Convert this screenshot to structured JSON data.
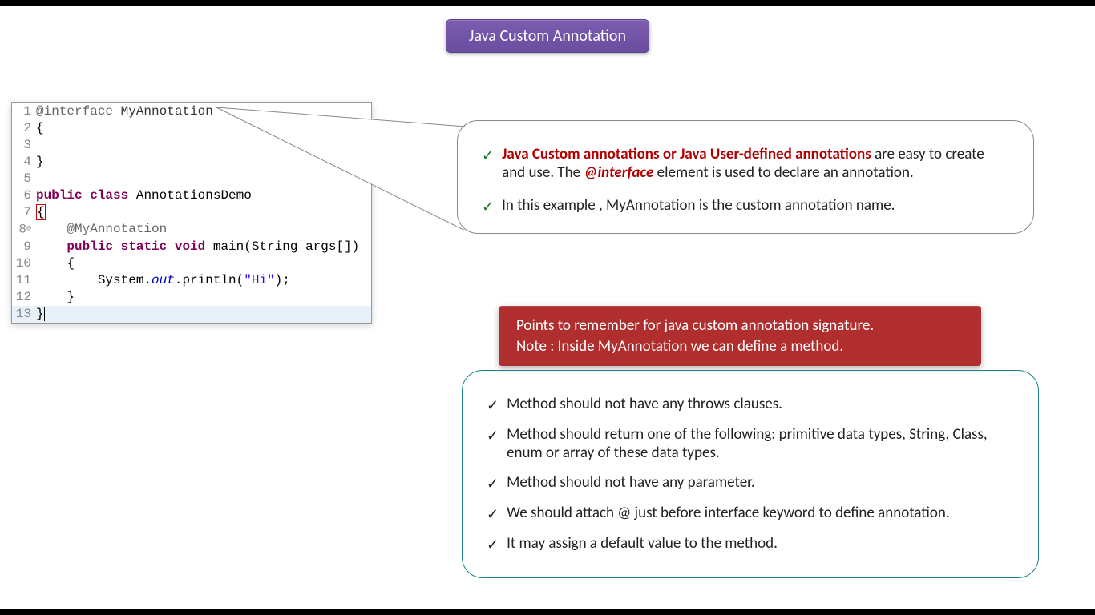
{
  "title": "Java Custom Annotation",
  "code": {
    "lines": [
      {
        "n": "1",
        "html": "<span class='anno'>@interface</span> <span class='type'>MyAnnotation</span>"
      },
      {
        "n": "2",
        "html": "{"
      },
      {
        "n": "3",
        "html": ""
      },
      {
        "n": "4",
        "html": "}"
      },
      {
        "n": "5",
        "html": ""
      },
      {
        "n": "6",
        "html": "<span class='kw'>public</span> <span class='kw'>class</span> AnnotationsDemo"
      },
      {
        "n": "7",
        "html": "<span class='err-box'>{</span>"
      },
      {
        "n": "8",
        "html": "    <span class='anno'>@MyAnnotation</span>",
        "fold": true
      },
      {
        "n": "9",
        "html": "    <span class='kw'>public</span> <span class='kw'>static</span> <span class='kw'>void</span> main(String args[])"
      },
      {
        "n": "10",
        "html": "    {"
      },
      {
        "n": "11",
        "html": "        System.<span class='staticfield'>out</span>.println(<span class='str'>\"Hi\"</span>);"
      },
      {
        "n": "12",
        "html": "    }"
      },
      {
        "n": "13",
        "html": "}<span style='border-left:1px solid #000;'></span>",
        "hl": true
      }
    ]
  },
  "explain": {
    "items": [
      {
        "html": "<span class='strong-red'>Java Custom annotations or Java User-defined annotations</span> are easy to create and use. The <span class='em-red-italic'>@interface</span> element is used to declare an annotation."
      },
      {
        "html": "In this example , MyAnnotation is the custom annotation name."
      }
    ]
  },
  "redNote": {
    "line1": "Points to remember for java custom annotation signature.",
    "line2": "Note : Inside MyAnnotation we can define a method."
  },
  "points": [
    "Method should not have any throws clauses.",
    "Method should return one of the following: primitive data types, String, Class, enum or array of these data types.",
    "Method should not have any parameter.",
    "We should attach @ just before interface keyword to define annotation.",
    "It may assign a default value to the method."
  ]
}
